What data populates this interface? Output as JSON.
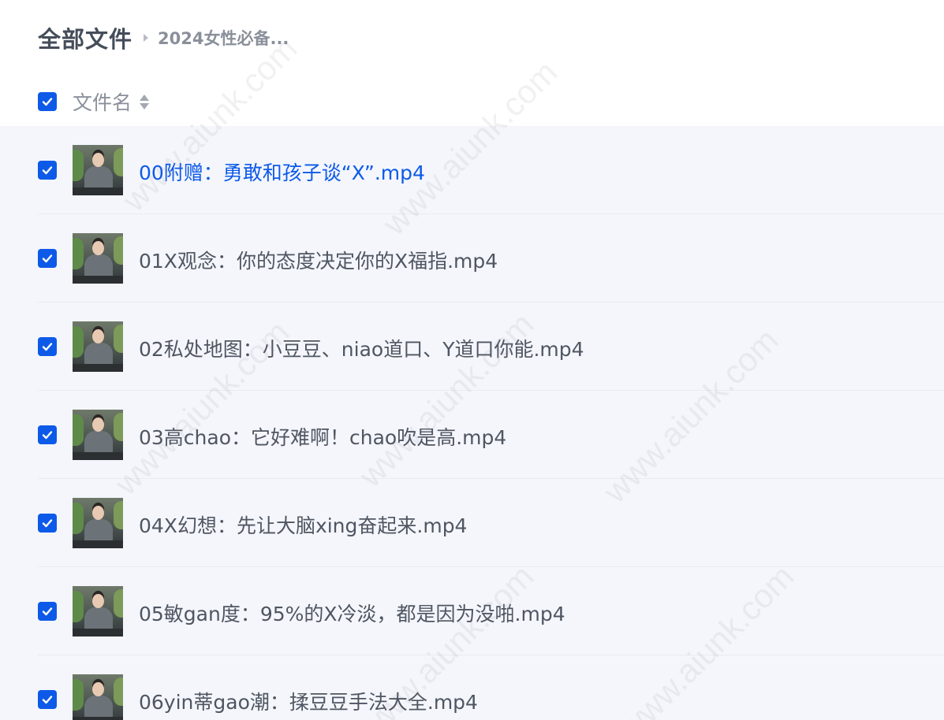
{
  "breadcrumb": {
    "root": "全部文件",
    "current": "2024女性必备..."
  },
  "header": {
    "column_name": "文件名",
    "all_checked": true
  },
  "files": [
    {
      "name": "00附赠：勇敢和孩子谈“X”.mp4",
      "checked": true,
      "active": true
    },
    {
      "name": "01X观念：你的态度决定你的X福指.mp4",
      "checked": true,
      "active": false
    },
    {
      "name": "02私处地图：小豆豆、niao道口、Y道口你能.mp4",
      "checked": true,
      "active": false
    },
    {
      "name": "03高chao：它好难啊！chao吹是高.mp4",
      "checked": true,
      "active": false
    },
    {
      "name": "04X幻想：先让大脑xing奋起来.mp4",
      "checked": true,
      "active": false
    },
    {
      "name": "05敏gan度：95%的X冷淡，都是因为没啪.mp4",
      "checked": true,
      "active": false
    },
    {
      "name": "06yin蒂gao潮：揉豆豆手法大全.mp4",
      "checked": true,
      "active": false
    }
  ],
  "watermark_text": "www.aiunk.com",
  "colors": {
    "accent": "#0d5ae8",
    "list_background": "#f4f6fc",
    "text": "#4f5661",
    "muted": "#8a909a"
  }
}
